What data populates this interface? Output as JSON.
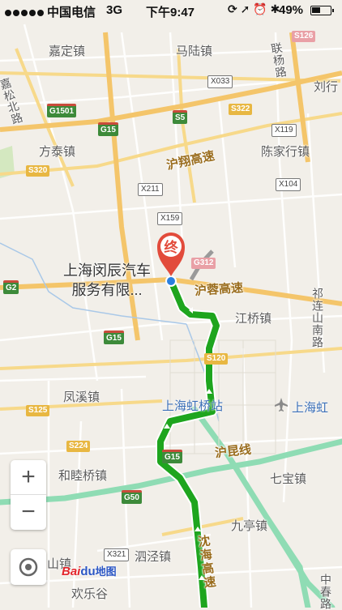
{
  "status_bar": {
    "carrier": "中国电信",
    "network": "3G",
    "time": "下午9:47",
    "battery_percent": "49%",
    "battery_level": 0.49,
    "icons": [
      "rotation-lock-icon",
      "location-arrow-icon",
      "alarm-icon",
      "bluetooth-icon"
    ]
  },
  "map": {
    "places": {
      "jiading": "嘉定镇",
      "malu": "马陆镇",
      "liuxing": "刘行",
      "fangtai": "方泰镇",
      "chenjiahang": "陈家行镇",
      "jiangqiao": "江桥镇",
      "fengxi": "凤溪镇",
      "hongqiao_station": "上海虹桥站",
      "hongqiao_airport": "上海虹",
      "qibao": "七宝镇",
      "hexiqiao": "和睦桥镇",
      "jiuting": "九亭镇",
      "sijing": "泗泾镇",
      "shanzhen": "山镇",
      "huanlegu": "欢乐谷",
      "jiasong_north": "嘉松北路",
      "lianyang": "联杨路",
      "qilian_south": "祁连山南路",
      "zhongchun": "中春路"
    },
    "roads": {
      "huxiang": "沪翔高速",
      "hurong": "沪蓉高速",
      "hukun": "沪昆线",
      "shenhai": "沈海高速"
    },
    "shields": {
      "s126": "S126",
      "x033": "X033",
      "g1501": "G1501",
      "s5": "S5",
      "s322": "S322",
      "g15_a": "G15",
      "x119": "X119",
      "s320": "S320",
      "x211": "X211",
      "x104": "X104",
      "x159": "X159",
      "g312": "G312",
      "g2": "G2",
      "g15_b": "G15",
      "s120": "S120",
      "s125": "S125",
      "s224": "S224",
      "g15_c": "G15",
      "g50": "G50",
      "x321": "X321"
    },
    "destination": {
      "marker": "终",
      "name_line1": "上海闵辰汽车",
      "name_line2": "服务有限..."
    },
    "colors": {
      "route": "#1ea51e",
      "route_casing": "#ffffff",
      "highway_teal": "#7fd3a8",
      "marker_red": "#e24b3b",
      "background": "#f2efe9"
    }
  },
  "controls": {
    "zoom_in": "+",
    "zoom_out": "−",
    "logo_bai": "Bai",
    "logo_du": "du",
    "logo_ditu": "地图"
  }
}
